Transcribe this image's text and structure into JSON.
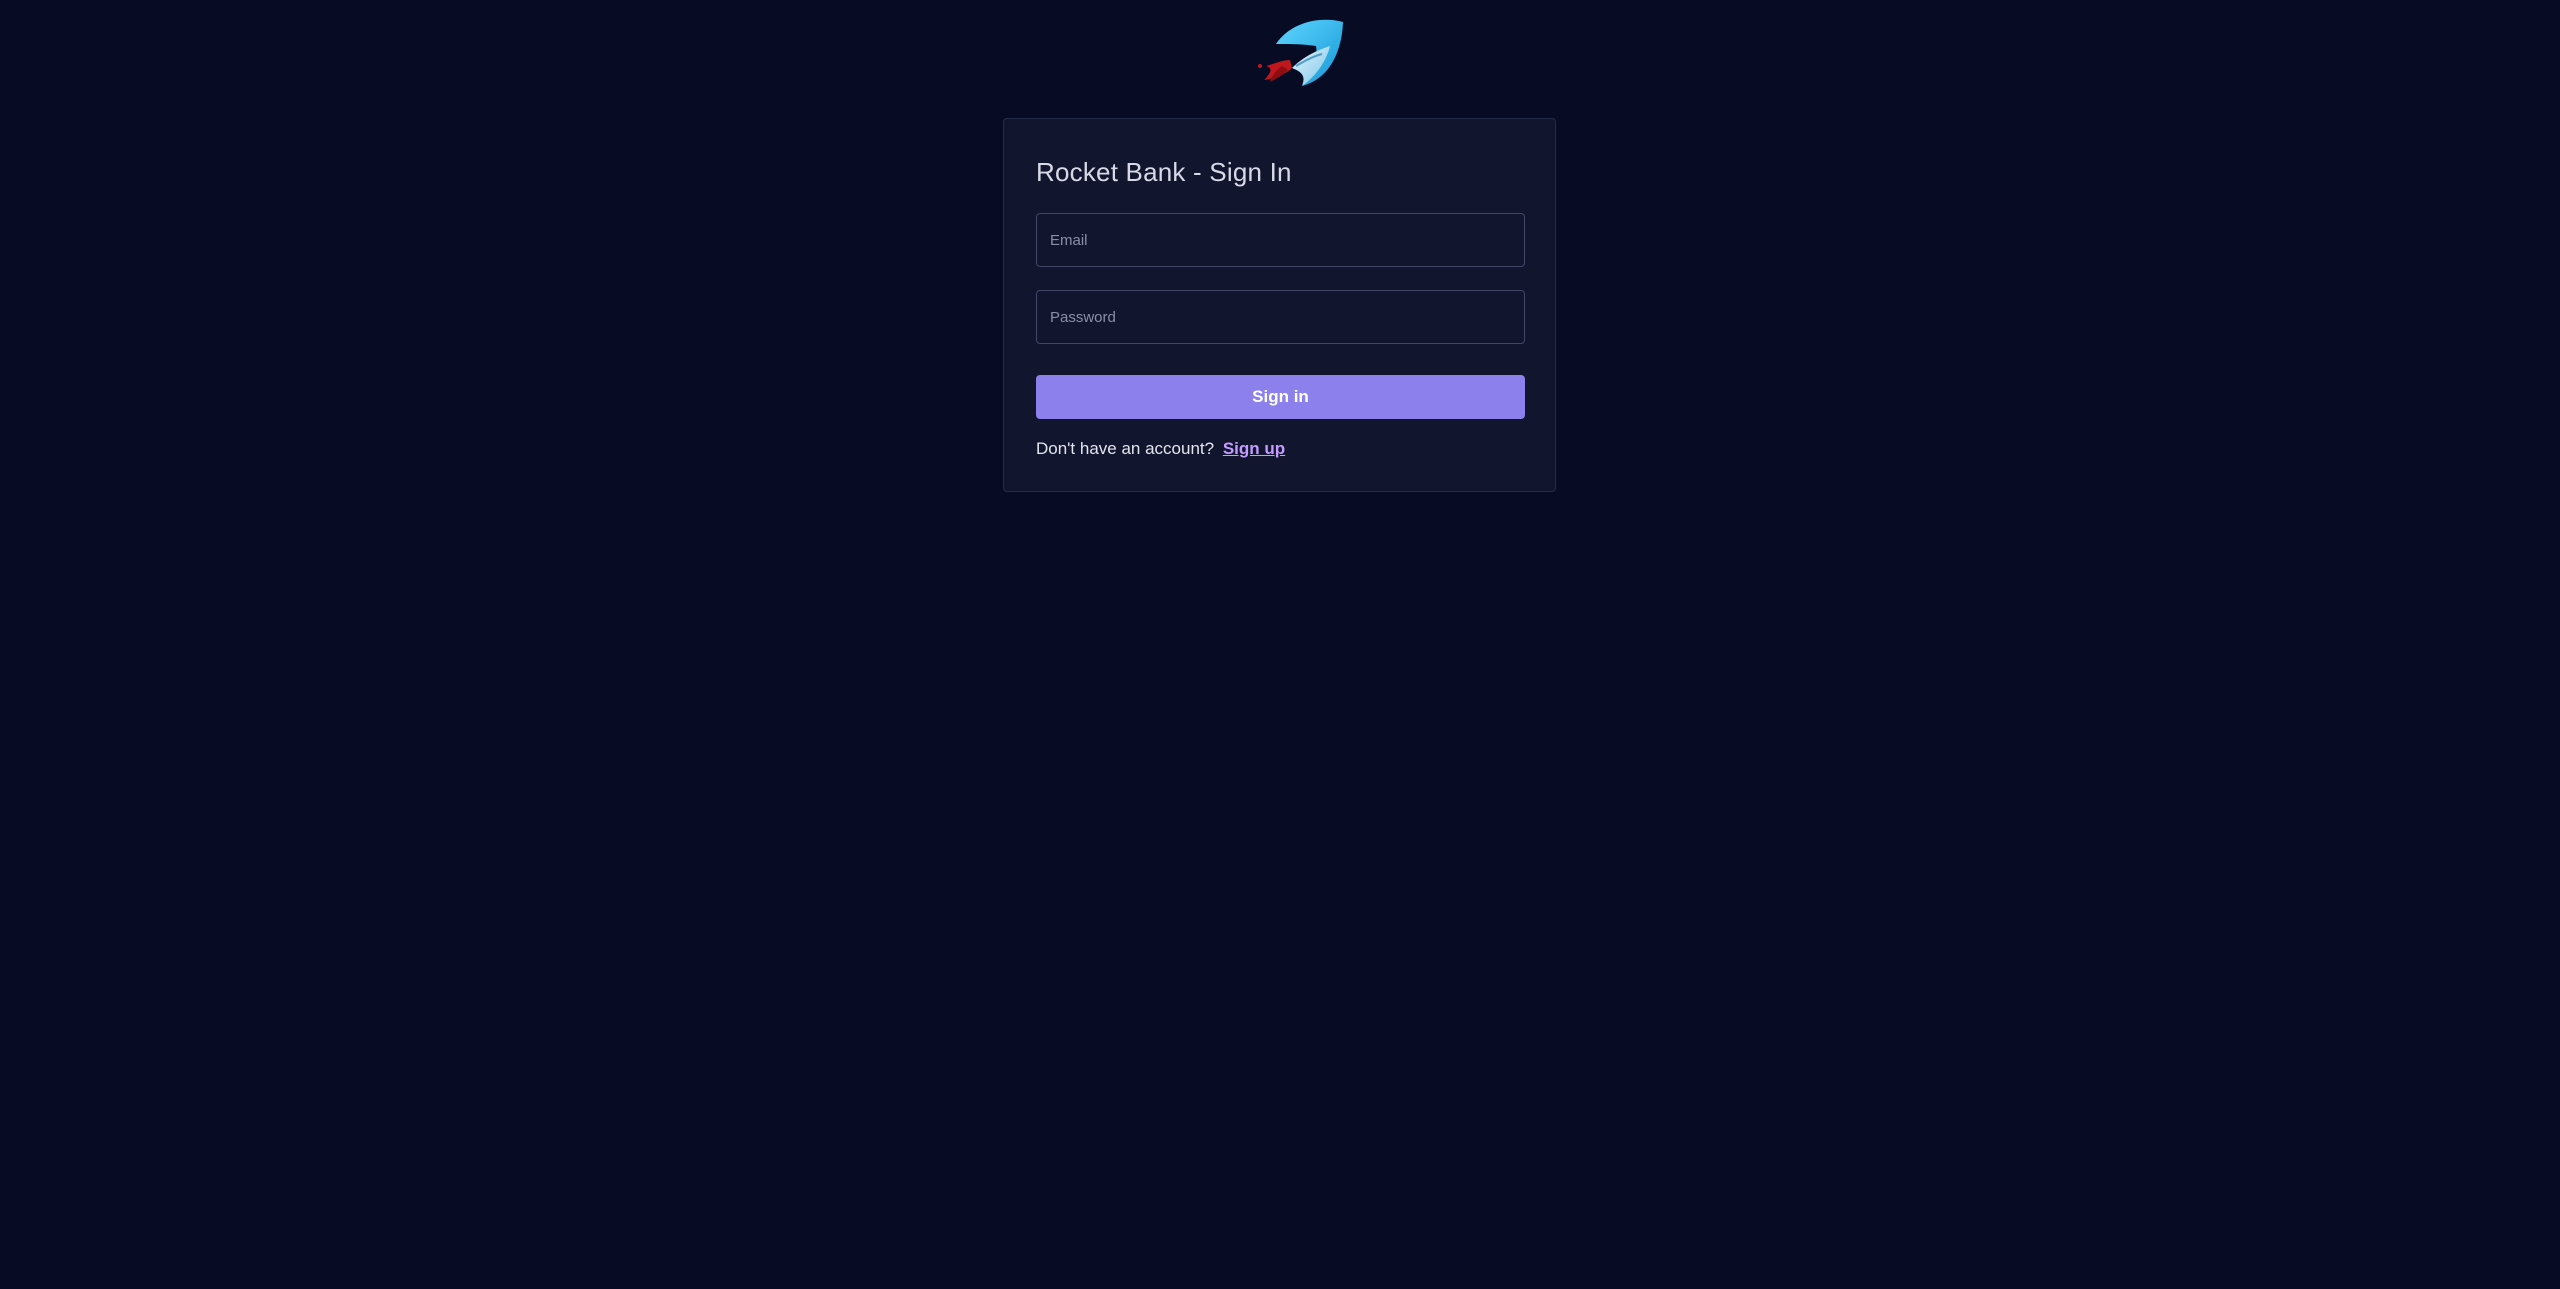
{
  "app": {
    "logo_icon": "rocket-logo-icon"
  },
  "signin_card": {
    "title": "Rocket Bank - Sign In",
    "email_placeholder": "Email",
    "email_value": "",
    "password_placeholder": "Password",
    "password_value": "",
    "submit_label": "Sign in",
    "no_account_text": "Don't have an account?",
    "signup_link_label": "Sign up"
  },
  "colors": {
    "background": "#070b24",
    "card": "#11152e",
    "accent": "#8b80ec",
    "link": "#c49bff",
    "logo_blue": "#29b6ef",
    "logo_red": "#c0171d"
  }
}
